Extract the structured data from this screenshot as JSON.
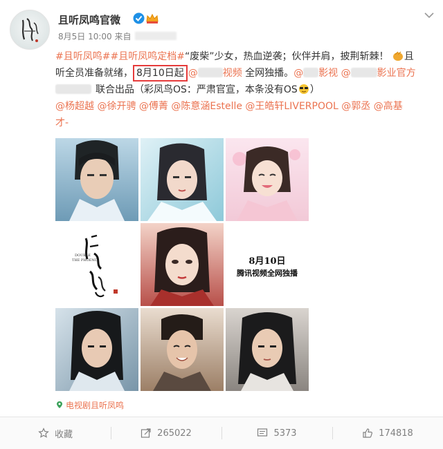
{
  "post": {
    "author": "且听凤鸣官微",
    "date": "8月5日 10:00",
    "source_prefix": "来自",
    "lines": {
      "l1_tag1": "#且听凤鸣#",
      "l1_tag2": "#且听凤鸣定档#",
      "l1_text": "“废柴”少女，热血逆袭；伙伴并肩，披荆斩棘！",
      "l1_end": "且",
      "l2_start": "听全员准备就绪，",
      "l2_highlight": "8月10日起",
      "l2_mention1": "@",
      "l2_mention1_tail": "视频",
      "l2_text": " 全网独播。",
      "l2_mention2": "@",
      "l2_mention2_tail": "影视",
      "l2_mention3": "@",
      "l2_mention3_tail": "影业官方",
      "l3_text": "联合出品（彩凤鸟OS：严肃官宣，本条没有OS",
      "l3_end": "）",
      "l4_mentions": "@杨超越 @徐开骋 @傅菁 @陈意涵Estelle @王皓轩LIVERPOOL @郭丞 @高基",
      "l5_mentions": "才-"
    },
    "poster_title_text": "8月10日",
    "poster_subtitle_text": "腾讯视频全网独播",
    "logo_small": "DOUBLE\nTHE PHOENIX",
    "location": "电视剧且听凤鸣"
  },
  "actions": {
    "favorite": "收藏",
    "repost": "265022",
    "comment": "5373",
    "like": "174818"
  },
  "colors": {
    "link": "#eb7350",
    "highlight_box": "#e63b3b",
    "verified": "#1e90e6"
  }
}
